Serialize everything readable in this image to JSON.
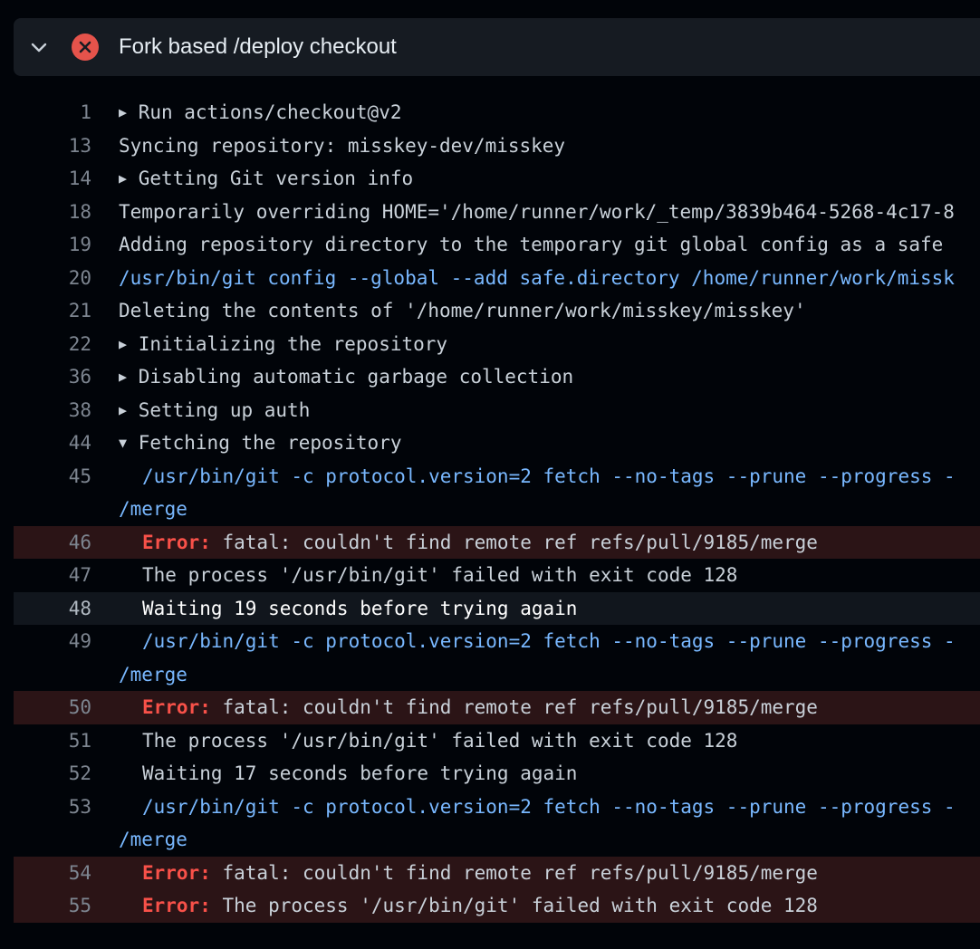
{
  "step": {
    "title": "Fork based /deploy checkout",
    "status": "failed",
    "status_color": "#e5534b",
    "expand_icon": "chevron-down-icon"
  },
  "log": [
    {
      "num": "1",
      "caret": "▶",
      "text": "Run actions/checkout@v2",
      "kind": "group"
    },
    {
      "num": "13",
      "text": "Syncing repository: misskey-dev/misskey",
      "kind": "text"
    },
    {
      "num": "14",
      "caret": "▶",
      "text": "Getting Git version info",
      "kind": "group"
    },
    {
      "num": "18",
      "text": "Temporarily overriding HOME='/home/runner/work/_temp/3839b464-5268-4c17-8",
      "kind": "text"
    },
    {
      "num": "19",
      "text": "Adding repository directory to the temporary git global config as a safe",
      "kind": "text"
    },
    {
      "num": "20",
      "text": "/usr/bin/git config --global --add safe.directory /home/runner/work/missk",
      "kind": "cmd"
    },
    {
      "num": "21",
      "text": "Deleting the contents of '/home/runner/work/misskey/misskey'",
      "kind": "text"
    },
    {
      "num": "22",
      "caret": "▶",
      "text": "Initializing the repository",
      "kind": "group"
    },
    {
      "num": "36",
      "caret": "▶",
      "text": "Disabling automatic garbage collection",
      "kind": "group"
    },
    {
      "num": "38",
      "caret": "▶",
      "text": "Setting up auth",
      "kind": "group"
    },
    {
      "num": "44",
      "caret": "▼",
      "text": "Fetching the repository",
      "kind": "group"
    },
    {
      "num": "45",
      "text": "/usr/bin/git -c protocol.version=2 fetch --no-tags --prune --progress -",
      "wrap": "/merge",
      "kind": "cmd-indent"
    },
    {
      "num": "46",
      "error_label": "Error:",
      "text": " fatal: couldn't find remote ref refs/pull/9185/merge",
      "kind": "error"
    },
    {
      "num": "47",
      "text": "The process '/usr/bin/git' failed with exit code 128",
      "kind": "text-indent"
    },
    {
      "num": "48",
      "text": "Waiting 19 seconds before trying again",
      "kind": "highlight"
    },
    {
      "num": "49",
      "text": "/usr/bin/git -c protocol.version=2 fetch --no-tags --prune --progress -",
      "wrap": "/merge",
      "kind": "cmd-indent"
    },
    {
      "num": "50",
      "error_label": "Error:",
      "text": " fatal: couldn't find remote ref refs/pull/9185/merge",
      "kind": "error"
    },
    {
      "num": "51",
      "text": "The process '/usr/bin/git' failed with exit code 128",
      "kind": "text-indent"
    },
    {
      "num": "52",
      "text": "Waiting 17 seconds before trying again",
      "kind": "text-indent"
    },
    {
      "num": "53",
      "text": "/usr/bin/git -c protocol.version=2 fetch --no-tags --prune --progress -",
      "wrap": "/merge",
      "kind": "cmd-indent"
    },
    {
      "num": "54",
      "error_label": "Error:",
      "text": " fatal: couldn't find remote ref refs/pull/9185/merge",
      "kind": "error"
    },
    {
      "num": "55",
      "error_label": "Error:",
      "text": " The process '/usr/bin/git' failed with exit code 128",
      "kind": "error"
    }
  ]
}
